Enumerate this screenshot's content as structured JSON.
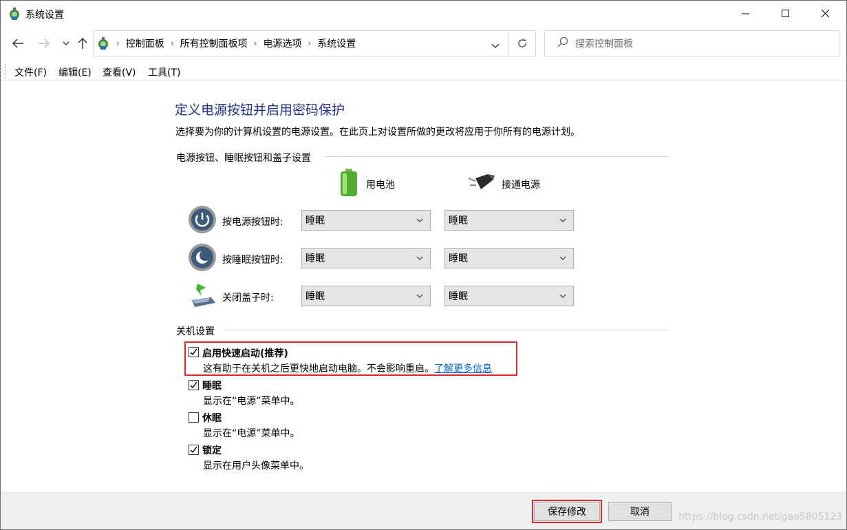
{
  "window": {
    "title": "系统设置"
  },
  "breadcrumb": [
    "控制面板",
    "所有控制面板项",
    "电源选项",
    "系统设置"
  ],
  "search": {
    "placeholder": "搜索控制面板"
  },
  "menu": [
    "文件(F)",
    "编辑(E)",
    "查看(V)",
    "工具(T)"
  ],
  "page": {
    "title": "定义电源按钮并启用密码保护",
    "description": "选择要为你的计算机设置的电源设置。在此页上对设置所做的更改将应用于你所有的电源计划。"
  },
  "power_buttons": {
    "group_label": "电源按钮、睡眠按钮和盖子设置",
    "battery_label": "用电池",
    "plugged_label": "接通电源",
    "rows": [
      {
        "label": "按电源按钮时:",
        "battery": "睡眠",
        "plugged": "睡眠"
      },
      {
        "label": "按睡眠按钮时:",
        "battery": "睡眠",
        "plugged": "睡眠"
      },
      {
        "label": "关闭盖子时:",
        "battery": "睡眠",
        "plugged": "睡眠"
      }
    ]
  },
  "shutdown": {
    "group_label": "关机设置",
    "options": [
      {
        "title": "启用快速启动(推荐)",
        "desc": "这有助于在关机之后更快地启动电脑。不会影响重启。",
        "link": "了解更多信息",
        "checked": true
      },
      {
        "title": "睡眠",
        "desc": "显示在“电源”菜单中。",
        "checked": true
      },
      {
        "title": "休眠",
        "desc": "显示在“电源”菜单中。",
        "checked": false
      },
      {
        "title": "锁定",
        "desc": "显示在用户头像菜单中。",
        "checked": true
      }
    ]
  },
  "footer": {
    "save": "保存修改",
    "cancel": "取消"
  },
  "watermark": "https://blog.csdn.net/gao5805123",
  "colors": {
    "title": "#1e3287",
    "link": "#0066cc",
    "highlight": "#e0282a"
  }
}
